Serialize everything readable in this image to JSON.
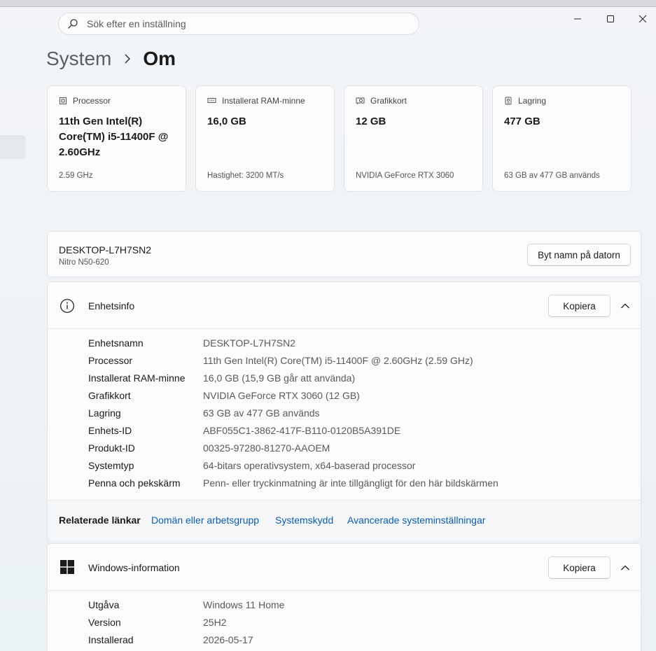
{
  "search": {
    "placeholder": "Sök efter en inställning"
  },
  "breadcrumb": {
    "parent": "System",
    "current": "Om"
  },
  "cards": [
    {
      "label": "Processor",
      "value": "11th Gen Intel(R) Core(TM) i5-11400F @ 2.60GHz",
      "sub": "2.59 GHz",
      "icon": "cpu-icon"
    },
    {
      "label": "Installerat RAM-minne",
      "value": "16,0 GB",
      "sub": "Hastighet: 3200 MT/s",
      "icon": "ram-icon"
    },
    {
      "label": "Grafikkort",
      "value": "12 GB",
      "sub": "NVIDIA GeForce RTX 3060",
      "icon": "gpu-icon"
    },
    {
      "label": "Lagring",
      "value": "477 GB",
      "sub": "63 GB av 477 GB används",
      "icon": "storage-icon"
    }
  ],
  "device": {
    "name": "DESKTOP-L7H7SN2",
    "model": "Nitro N50-620",
    "rename_label": "Byt namn på datorn"
  },
  "device_info": {
    "title": "Enhetsinfo",
    "copy_label": "Kopiera",
    "rows": [
      {
        "k": "Enhetsnamn",
        "v": "DESKTOP-L7H7SN2"
      },
      {
        "k": "Processor",
        "v": "11th Gen Intel(R) Core(TM) i5-11400F @ 2.60GHz (2.59 GHz)"
      },
      {
        "k": "Installerat RAM-minne",
        "v": "16,0 GB (15,9 GB går att använda)"
      },
      {
        "k": "Grafikkort",
        "v": "NVIDIA GeForce RTX 3060 (12 GB)"
      },
      {
        "k": "Lagring",
        "v": "63 GB av 477 GB används"
      },
      {
        "k": "Enhets-ID",
        "v": "ABF055C1-3862-417F-B110-0120B5A391DE"
      },
      {
        "k": "Produkt-ID",
        "v": "00325-97280-81270-AAOEM"
      },
      {
        "k": "Systemtyp",
        "v": "64-bitars operativsystem, x64-baserad processor"
      },
      {
        "k": "Penna och pekskärm",
        "v": "Penn- eller tryckinmatning är inte tillgängligt för den här bildskärmen"
      }
    ]
  },
  "related": {
    "label": "Relaterade länkar",
    "links": [
      "Domän eller arbetsgrupp",
      "Systemskydd",
      "Avancerade systeminställningar"
    ]
  },
  "windows_info": {
    "title": "Windows-information",
    "copy_label": "Kopiera",
    "rows": [
      {
        "k": "Utgåva",
        "v": "Windows 11 Home"
      },
      {
        "k": "Version",
        "v": "25H2"
      },
      {
        "k": "Installerad",
        "v": "2026-05-17"
      }
    ]
  },
  "colors": {
    "accent_link": "#0b5cad",
    "background": "#eef3f8",
    "card": "#fbfbfb"
  }
}
